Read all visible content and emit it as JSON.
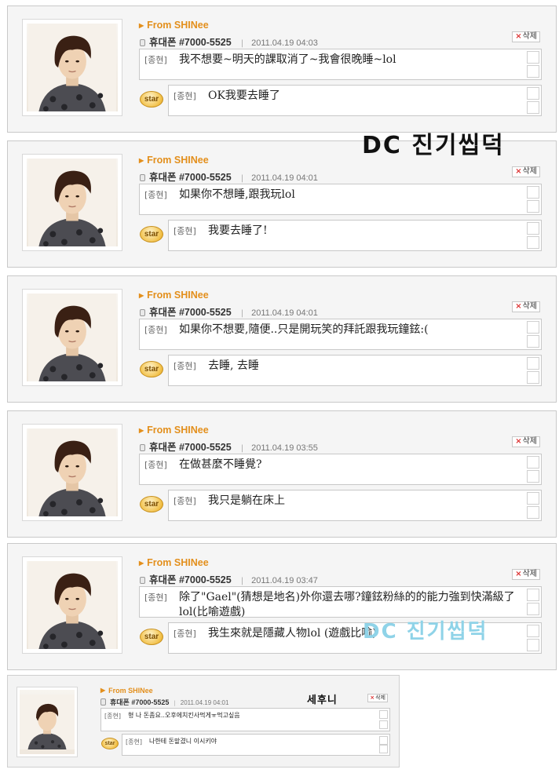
{
  "colors": {
    "from_accent": "#e38f1c",
    "watermark_blue": "#8fd3e8",
    "card_bg": "#f5f5f5"
  },
  "cards": [
    {
      "from": "From SHINee",
      "phone": "휴대폰 #7000-5525",
      "date": "2011.04.19 04:03",
      "delete_label": "삭제",
      "msg1_tag": "[종현]",
      "msg1": "我不想要~明天的課取消了~我會很晚睡~lol",
      "star_label": "star",
      "msg2_tag": "[종현]",
      "msg2": "OK我要去睡了"
    },
    {
      "from": "From SHINee",
      "phone": "휴대폰 #7000-5525",
      "date": "2011.04.19 04:01",
      "delete_label": "삭제",
      "msg1_tag": "[종현]",
      "msg1": "如果你不想睡,跟我玩lol",
      "star_label": "star",
      "msg2_tag": "[종현]",
      "msg2": "我要去睡了!"
    },
    {
      "from": "From SHINee",
      "phone": "휴대폰 #7000-5525",
      "date": "2011.04.19 04:01",
      "delete_label": "삭제",
      "msg1_tag": "[종현]",
      "msg1": "如果你不想要,隨便..只是開玩笑的拜託跟我玩鐘鉉:(",
      "star_label": "star",
      "msg2_tag": "[종현]",
      "msg2": "去睡, 去睡"
    },
    {
      "from": "From SHINee",
      "phone": "휴대폰 #7000-5525",
      "date": "2011.04.19 03:55",
      "delete_label": "삭제",
      "msg1_tag": "[종현]",
      "msg1": "在做甚麼不睡覺?",
      "star_label": "star",
      "msg2_tag": "[종현]",
      "msg2": "我只是躺在床上"
    },
    {
      "from": "From SHINee",
      "phone": "휴대폰 #7000-5525",
      "date": "2011.04.19 03:47",
      "delete_label": "삭제",
      "msg1_tag": "[종현]",
      "msg1": "除了\"Gael\"(猜想是地名)外你還去哪?鐘鉉粉絲的的能力強到快滿級了lol(比喻遊戲)",
      "star_label": "star",
      "msg2_tag": "[종현]",
      "msg2": "我生來就是隱藏人物lol (遊戲比喻)"
    }
  ],
  "mini": {
    "from": "From SHINee",
    "phone": "휴대폰 #7000-5525",
    "date": "2011.04.19 04:01",
    "delete_label": "삭제",
    "label": "세후니",
    "msg1_tag": "[종현]",
    "msg1": "형 나 돈좀요..오후에치킨사먹게ㅠ먹고싶음",
    "star_label": "star",
    "msg2_tag": "[종현]",
    "msg2": "나한테 돈맡겼니 이시키야"
  },
  "watermarks": {
    "dark": "DC 진기씹덕",
    "blue": "DC 진기씹덕"
  }
}
